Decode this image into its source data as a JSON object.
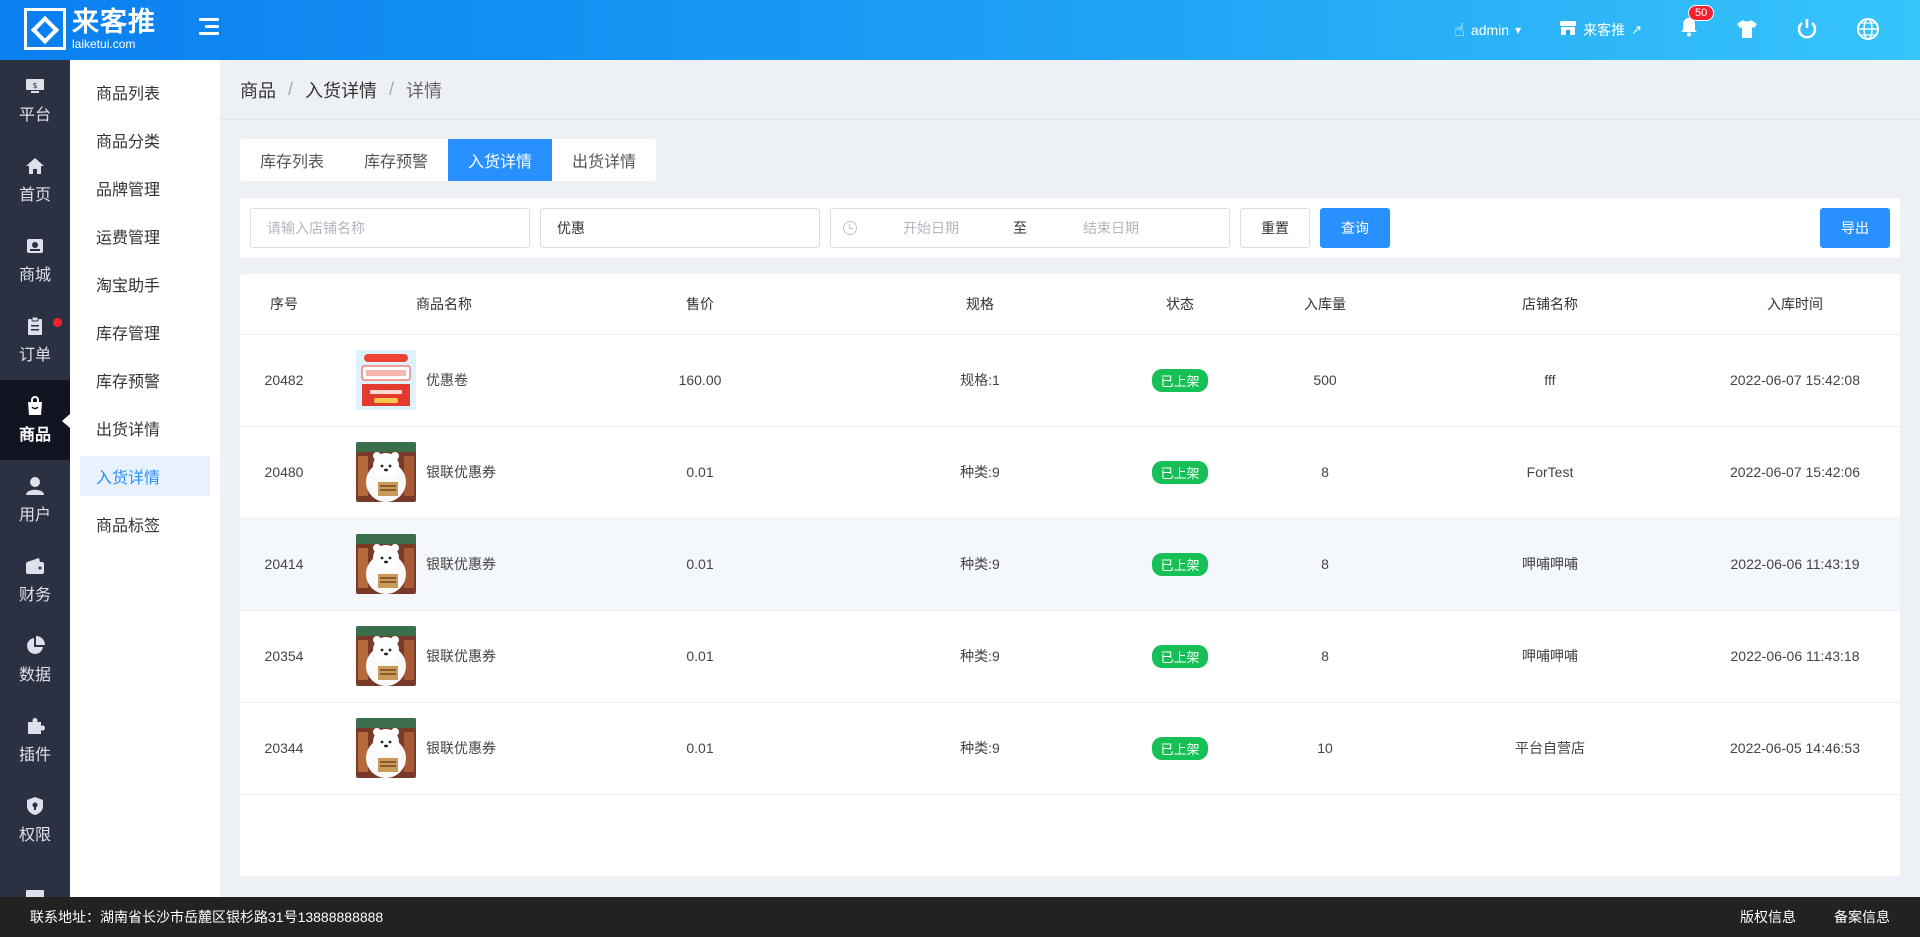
{
  "header": {
    "logo_name": "来客推",
    "logo_url": "laiketui.com",
    "user": "admin",
    "store": "来客推",
    "notifications_count": "50"
  },
  "rail": [
    {
      "label": "平台",
      "icon": "platform-icon"
    },
    {
      "label": "首页",
      "icon": "home-icon"
    },
    {
      "label": "商城",
      "icon": "mall-icon"
    },
    {
      "label": "订单",
      "icon": "order-icon"
    },
    {
      "label": "商品",
      "icon": "goods-icon"
    },
    {
      "label": "用户",
      "icon": "user-icon"
    },
    {
      "label": "财务",
      "icon": "wallet-icon"
    },
    {
      "label": "数据",
      "icon": "pie-chart-icon"
    },
    {
      "label": "插件",
      "icon": "puzzle-icon"
    },
    {
      "label": "权限",
      "icon": "shield-icon"
    }
  ],
  "submenu": [
    "商品列表",
    "商品分类",
    "品牌管理",
    "运费管理",
    "淘宝助手",
    "库存管理",
    "库存预警",
    "出货详情",
    "入货详情",
    "商品标签"
  ],
  "breadcrumb": [
    "商品",
    "入货详情",
    "详情"
  ],
  "tabs": [
    "库存列表",
    "库存预警",
    "入货详情",
    "出货详情"
  ],
  "filter": {
    "store_placeholder": "请输入店铺名称",
    "keyword_value": "优惠",
    "start_placeholder": "开始日期",
    "to_label": "至",
    "end_placeholder": "结束日期",
    "reset_label": "重置",
    "query_label": "查询",
    "export_label": "导出"
  },
  "table": {
    "headers": [
      "序号",
      "商品名称",
      "售价",
      "规格",
      "状态",
      "入库量",
      "店铺名称",
      "入库时间"
    ],
    "rows": [
      {
        "id": "20482",
        "name": "优惠卷",
        "price": "160.00",
        "spec": "规格:1",
        "status": "已上架",
        "qty": "500",
        "store": "fff",
        "time": "2022-06-07 15:42:08",
        "thumb": "coupon"
      },
      {
        "id": "20480",
        "name": "银联优惠券",
        "price": "0.01",
        "spec": "种类:9",
        "status": "已上架",
        "qty": "8",
        "store": "ForTest",
        "time": "2022-06-07 15:42:06",
        "thumb": "bear"
      },
      {
        "id": "20414",
        "name": "银联优惠券",
        "price": "0.01",
        "spec": "种类:9",
        "status": "已上架",
        "qty": "8",
        "store": "呷哺呷哺",
        "time": "2022-06-06 11:43:19",
        "thumb": "bear"
      },
      {
        "id": "20354",
        "name": "银联优惠券",
        "price": "0.01",
        "spec": "种类:9",
        "status": "已上架",
        "qty": "8",
        "store": "呷哺呷哺",
        "time": "2022-06-06 11:43:18",
        "thumb": "bear"
      },
      {
        "id": "20344",
        "name": "银联优惠券",
        "price": "0.01",
        "spec": "种类:9",
        "status": "已上架",
        "qty": "10",
        "store": "平台自营店",
        "time": "2022-06-05 14:46:53",
        "thumb": "bear"
      }
    ]
  },
  "footer": {
    "address": "联系地址：湖南省长沙市岳麓区银杉路31号13888888888",
    "copyright": "版权信息",
    "record": "备案信息"
  }
}
